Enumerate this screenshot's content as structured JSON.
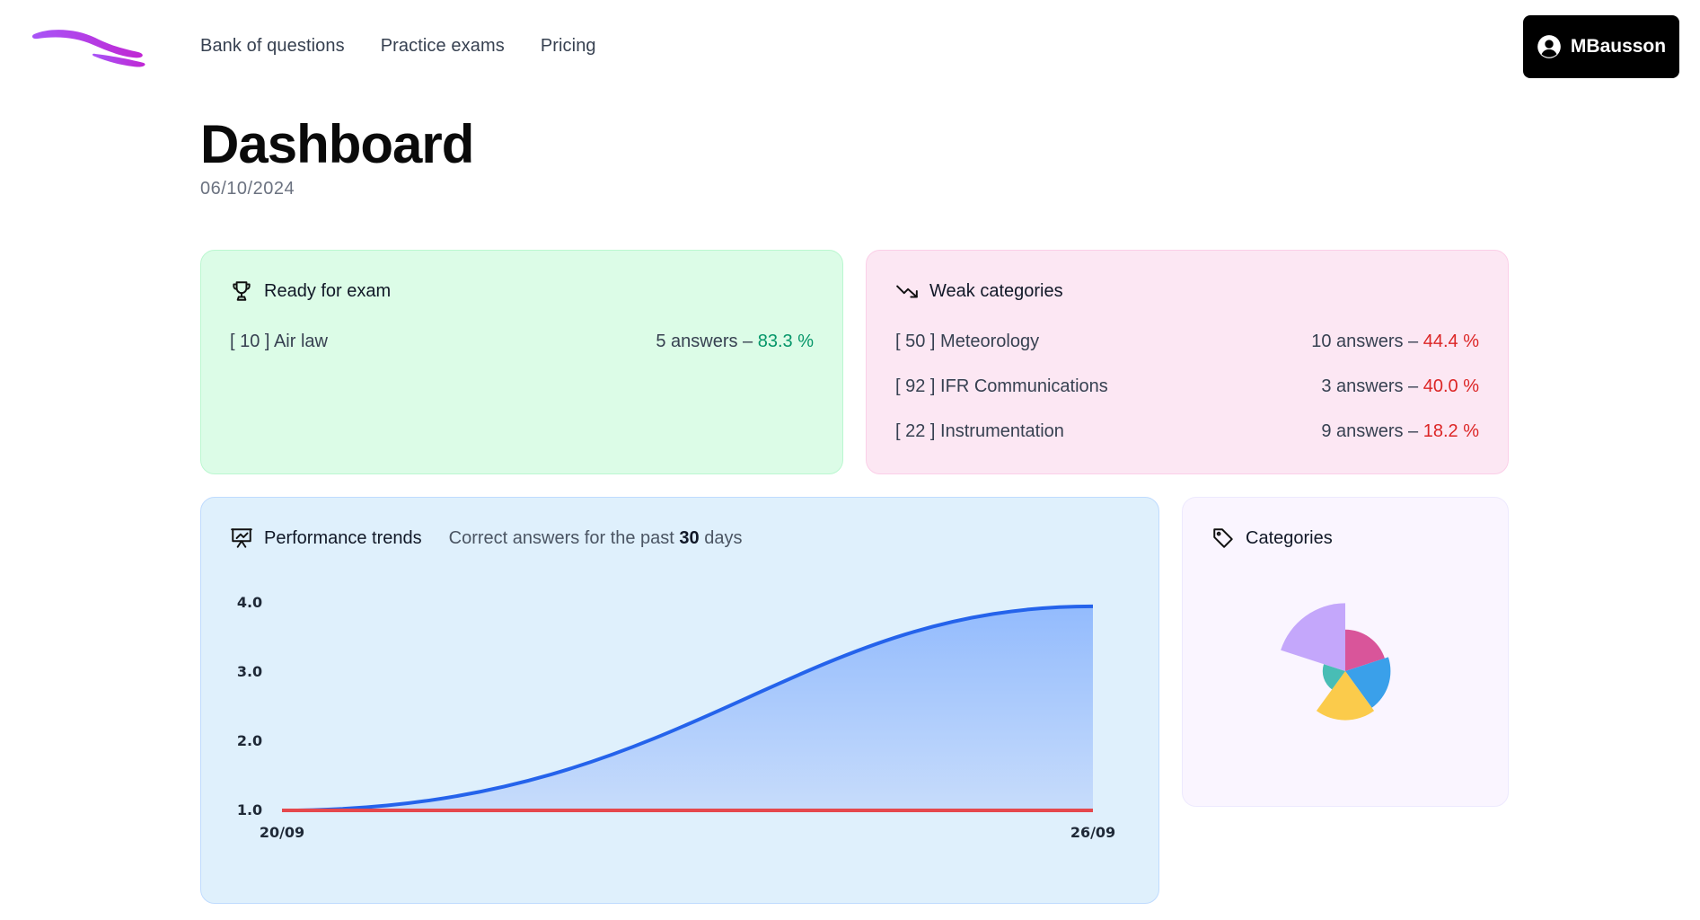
{
  "nav": {
    "items": [
      "Bank of questions",
      "Practice exams",
      "Pricing"
    ],
    "user_label": "MBausson"
  },
  "page": {
    "title": "Dashboard",
    "date": "06/10/2024"
  },
  "ready": {
    "title": "Ready for exam",
    "rows": [
      {
        "code": "[ 10 ]",
        "name": "Air law",
        "answers": "5",
        "answers_word": "answers –",
        "pct": "83.3 %"
      }
    ]
  },
  "weak": {
    "title": "Weak categories",
    "rows": [
      {
        "code": "[ 50 ]",
        "name": "Meteorology",
        "answers": "10",
        "answers_word": "answers –",
        "pct": "44.4 %"
      },
      {
        "code": "[ 92 ]",
        "name": "IFR Communications",
        "answers": "3",
        "answers_word": "answers –",
        "pct": "40.0 %"
      },
      {
        "code": "[ 22 ]",
        "name": "Instrumentation",
        "answers": "9",
        "answers_word": "answers –",
        "pct": "18.2 %"
      }
    ]
  },
  "performance": {
    "title": "Performance trends",
    "subtitle_prefix": "Correct answers for the past",
    "subtitle_days": "30",
    "subtitle_suffix": "days"
  },
  "categories": {
    "title": "Categories"
  },
  "colors": {
    "line": "#2563eb",
    "area_top": "#93bbfd",
    "area_bottom": "#c7dcfb",
    "baseline": "#e5484d",
    "pie": [
      "#c4a7fb",
      "#d9559a",
      "#3aa0ea",
      "#fbcb4b",
      "#48bdb5"
    ]
  },
  "chart_data": [
    {
      "type": "area",
      "x": [
        "20/09",
        "26/09"
      ],
      "xlabel": "",
      "ylabel": "",
      "ylim": [
        1.0,
        4.0
      ],
      "yticks": [
        "1.0",
        "2.0",
        "3.0",
        "4.0"
      ],
      "series": [
        {
          "values": [
            1.0,
            3.95
          ]
        },
        {
          "values": [
            1.0,
            1.0
          ]
        }
      ],
      "grid": false
    },
    {
      "type": "pie",
      "variant": "polar-area",
      "slices": [
        {
          "value": 0.9
        },
        {
          "value": 0.55
        },
        {
          "value": 0.6
        },
        {
          "value": 0.65
        },
        {
          "value": 0.3
        }
      ]
    }
  ]
}
